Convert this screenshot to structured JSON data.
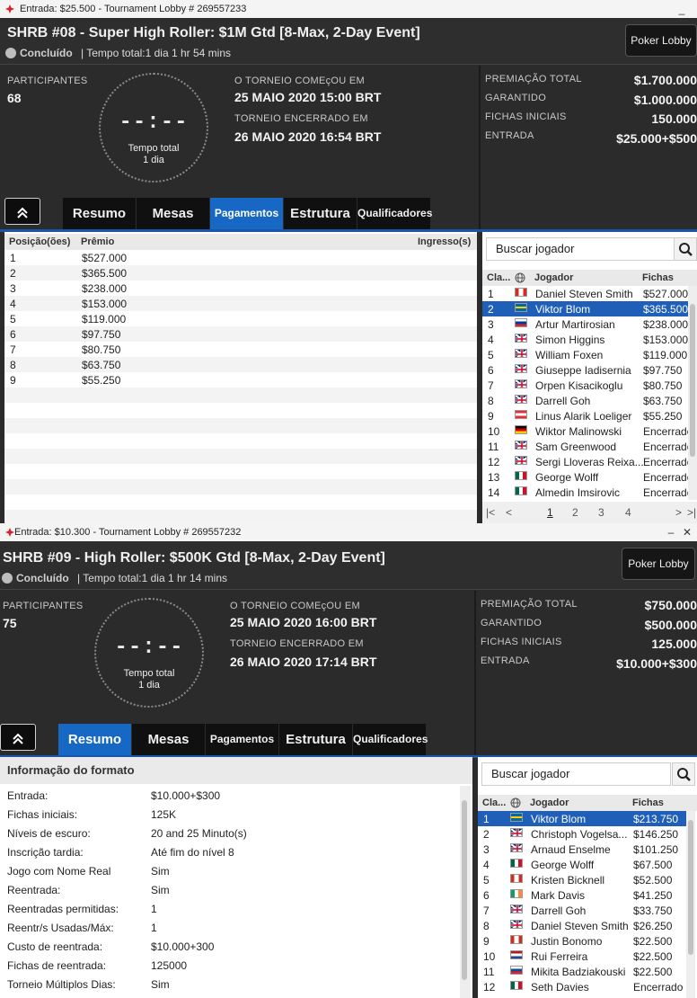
{
  "lobbies": [
    {
      "window_title": "Entrada: $25.500 - Tournament Lobby # 269557233",
      "title": "SHRB #08 - Super High Roller: $1M Gtd [8-Max, 2-Day Event]",
      "status": "Concluído",
      "total_time": "| Tempo total:1 dia 1 hr  54 mins",
      "lobby_button": "Poker Lobby",
      "participants_label": "PARTICIPANTES",
      "participants": "68",
      "clock_digits": "--:--",
      "clock_label1": "Tempo total",
      "clock_label2": "1 dia",
      "start_label": "O TORNEIO COMEçOU EM",
      "start_value": "25 MAIO 2020  15:00 BRT",
      "end_label": "TORNEIO ENCERRADO EM",
      "end_value": "26 MAIO 2020  16:54 BRT",
      "prize": [
        {
          "label": "PREMIAÇÃO TOTAL",
          "value": "$1.700.000"
        },
        {
          "label": "GARANTIDO",
          "value": "$1.000.000"
        },
        {
          "label": "FICHAS INICIAIS",
          "value": "150.000"
        },
        {
          "label": "ENTRADA",
          "value": "$25.000+$500"
        }
      ],
      "tabs": [
        {
          "label": "Resumo",
          "active": false
        },
        {
          "label": "Mesas",
          "active": false
        },
        {
          "label": "Pagamentos",
          "active": true
        },
        {
          "label": "Estrutura",
          "active": false
        },
        {
          "label": "Qualificadores",
          "active": false
        }
      ],
      "payouts": {
        "headers": [
          "Posição(ões)",
          "Prêmio",
          "Ingresso(s)"
        ],
        "rows": [
          {
            "pos": "1",
            "prize": "$527.000"
          },
          {
            "pos": "2",
            "prize": "$365.500"
          },
          {
            "pos": "3",
            "prize": "$238.000"
          },
          {
            "pos": "4",
            "prize": "$153.000"
          },
          {
            "pos": "5",
            "prize": "$119.000"
          },
          {
            "pos": "6",
            "prize": "$97.750"
          },
          {
            "pos": "7",
            "prize": "$80.750"
          },
          {
            "pos": "8",
            "prize": "$63.750"
          },
          {
            "pos": "9",
            "prize": "$55.250"
          }
        ]
      },
      "search_placeholder": "Buscar jogador",
      "players_headers": [
        "Cla...",
        "Jogador",
        "Fichas"
      ],
      "players": [
        {
          "rank": "1",
          "flag": "ca",
          "name": "Daniel Steven Smith",
          "chips": "$527.000"
        },
        {
          "rank": "2",
          "flag": "se",
          "name": "Viktor Blom",
          "chips": "$365.500",
          "selected": true
        },
        {
          "rank": "3",
          "flag": "ru",
          "name": "Artur Martirosian",
          "chips": "$238.000"
        },
        {
          "rank": "4",
          "flag": "gb",
          "name": "Simon Higgins",
          "chips": "$153.000"
        },
        {
          "rank": "5",
          "flag": "gb",
          "name": "William Foxen",
          "chips": "$119.000"
        },
        {
          "rank": "6",
          "flag": "gb",
          "name": "Giuseppe Iadisernia",
          "chips": "$97.750"
        },
        {
          "rank": "7",
          "flag": "gb",
          "name": "Orpen Kisacikoglu",
          "chips": "$80.750"
        },
        {
          "rank": "8",
          "flag": "gb",
          "name": "Darrell Goh",
          "chips": "$63.750"
        },
        {
          "rank": "9",
          "flag": "at",
          "name": "Linus Alarik Loeliger",
          "chips": "$55.250"
        },
        {
          "rank": "10",
          "flag": "de",
          "name": "Wiktor Malinowski",
          "chips": "Encerrado"
        },
        {
          "rank": "11",
          "flag": "gb",
          "name": "Sam Greenwood",
          "chips": "Encerrado"
        },
        {
          "rank": "12",
          "flag": "gb",
          "name": "Sergi Lloveras Reixa...",
          "chips": "Encerrado"
        },
        {
          "rank": "13",
          "flag": "mx",
          "name": "George Wolff",
          "chips": "Encerrado"
        },
        {
          "rank": "14",
          "flag": "mx",
          "name": "Almedin Imsirovic",
          "chips": "Encerrado"
        }
      ],
      "pages": [
        "1",
        "2",
        "3",
        "4"
      ]
    },
    {
      "window_title": "Entrada: $10.300 - Tournament Lobby # 269557232",
      "title": "SHRB #09 - High Roller: $500K Gtd [8-Max, 2-Day Event]",
      "status": "Concluído",
      "total_time": "| Tempo total:1 dia 1 hr  14 mins",
      "lobby_button": "Poker Lobby",
      "participants_label": "PARTICIPANTES",
      "participants": "75",
      "clock_digits": "--:--",
      "clock_label1": "Tempo total",
      "clock_label2": "1 dia",
      "start_label": "O TORNEIO COMEçOU EM",
      "start_value": "25 MAIO 2020  16:00 BRT",
      "end_label": "TORNEIO ENCERRADO EM",
      "end_value": "26 MAIO 2020  17:14 BRT",
      "prize": [
        {
          "label": "PREMIAÇÃO TOTAL",
          "value": "$750.000"
        },
        {
          "label": "GARANTIDO",
          "value": "$500.000"
        },
        {
          "label": "FICHAS INICIAIS",
          "value": "125.000"
        },
        {
          "label": "ENTRADA",
          "value": "$10.000+$300"
        }
      ],
      "tabs": [
        {
          "label": "Resumo",
          "active": true
        },
        {
          "label": "Mesas",
          "active": false
        },
        {
          "label": "Pagamentos",
          "active": false
        },
        {
          "label": "Estrutura",
          "active": false
        },
        {
          "label": "Qualificadores",
          "active": false
        }
      ],
      "format_title": "Informação do formato",
      "format": [
        {
          "k": "Entrada:",
          "v": "$10.000+$300"
        },
        {
          "k": "Fichas iniciais:",
          "v": "125K"
        },
        {
          "k": "Níveis de escuro:",
          "v": "20 and 25 Minuto(s)"
        },
        {
          "k": "Inscrição tardia:",
          "v": "Até fim do nível 8"
        },
        {
          "k": "Jogo com Nome Real",
          "v": "Sim"
        },
        {
          "k": "Reentrada:",
          "v": "Sim"
        },
        {
          "k": "Reentradas permitidas:",
          "v": "1"
        },
        {
          "k": "Reentr/s Usadas/Máx:",
          "v": "1"
        },
        {
          "k": "Custo de reentrada:",
          "v": "$10.000+300"
        },
        {
          "k": "Fichas de reentrada:",
          "v": "125000"
        },
        {
          "k": "Torneio Múltiplos Dias:",
          "v": "Sim"
        }
      ],
      "search_placeholder": "Buscar jogador",
      "players_headers": [
        "Cla...",
        "Jogador",
        "Fichas"
      ],
      "players": [
        {
          "rank": "1",
          "flag": "se",
          "name": "Viktor Blom",
          "chips": "$213.750",
          "selected": true
        },
        {
          "rank": "2",
          "flag": "gb",
          "name": "Christoph Vogelsa...",
          "chips": "$146.250"
        },
        {
          "rank": "3",
          "flag": "gb",
          "name": "Arnaud Enselme",
          "chips": "$101.250"
        },
        {
          "rank": "4",
          "flag": "mx",
          "name": "George Wolff",
          "chips": "$67.500"
        },
        {
          "rank": "5",
          "flag": "ca",
          "name": "Kristen Bicknell",
          "chips": "$52.500"
        },
        {
          "rank": "6",
          "flag": "ie",
          "name": "Mark Davis",
          "chips": "$41.250"
        },
        {
          "rank": "7",
          "flag": "gb",
          "name": "Darrell Goh",
          "chips": "$33.750"
        },
        {
          "rank": "8",
          "flag": "gb",
          "name": "Daniel Steven Smith",
          "chips": "$26.250"
        },
        {
          "rank": "9",
          "flag": "ca",
          "name": "Justin Bonomo",
          "chips": "$22.500"
        },
        {
          "rank": "10",
          "flag": "nl",
          "name": "Rui Ferreira",
          "chips": "$22.500"
        },
        {
          "rank": "11",
          "flag": "sk",
          "name": "Mikita Badziakouski",
          "chips": "$22.500"
        },
        {
          "rank": "12",
          "flag": "mx",
          "name": "Seth Davies",
          "chips": "Encerrado"
        }
      ]
    }
  ],
  "colors": {
    "accent": "#1668c4",
    "selected_row": "#1f5fb8",
    "dark_bg": "#2b2b2b"
  }
}
